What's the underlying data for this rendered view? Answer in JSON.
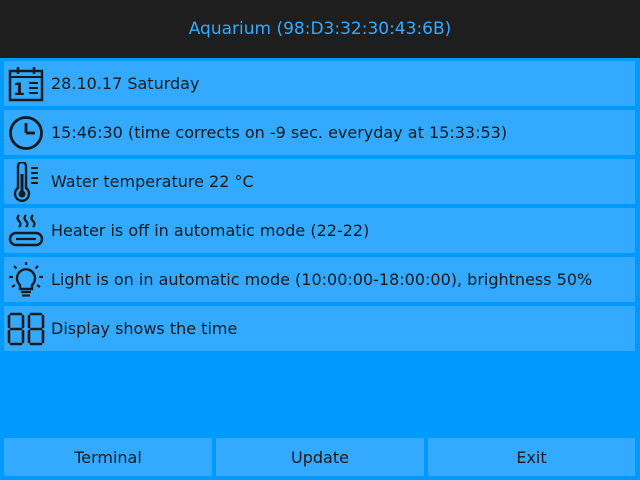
{
  "header": {
    "title": "Aquarium (98:D3:32:30:43:6B)"
  },
  "rows": [
    {
      "icon": "calendar-icon",
      "icon_text": "1",
      "text": "28.10.17 Saturday"
    },
    {
      "icon": "clock-icon",
      "text": "15:46:30 (time corrects on -9 sec. everyday at 15:33:53)"
    },
    {
      "icon": "thermometer-icon",
      "text": "Water temperature 22 °C"
    },
    {
      "icon": "heater-icon",
      "text": "Heater is off in automatic mode (22-22)"
    },
    {
      "icon": "lightbulb-icon",
      "text": "Light is on in automatic mode (10:00:00-18:00:00), brightness 50%"
    },
    {
      "icon": "seven-segment-display-icon",
      "text": "Display shows the time"
    }
  ],
  "buttons": {
    "terminal": "Terminal",
    "update": "Update",
    "exit": "Exit"
  },
  "colors": {
    "background": "#0099ff",
    "panel": "#33aaff",
    "header_bg": "#1e1e1e",
    "header_text": "#33aaff",
    "text": "#1a1a1a"
  }
}
